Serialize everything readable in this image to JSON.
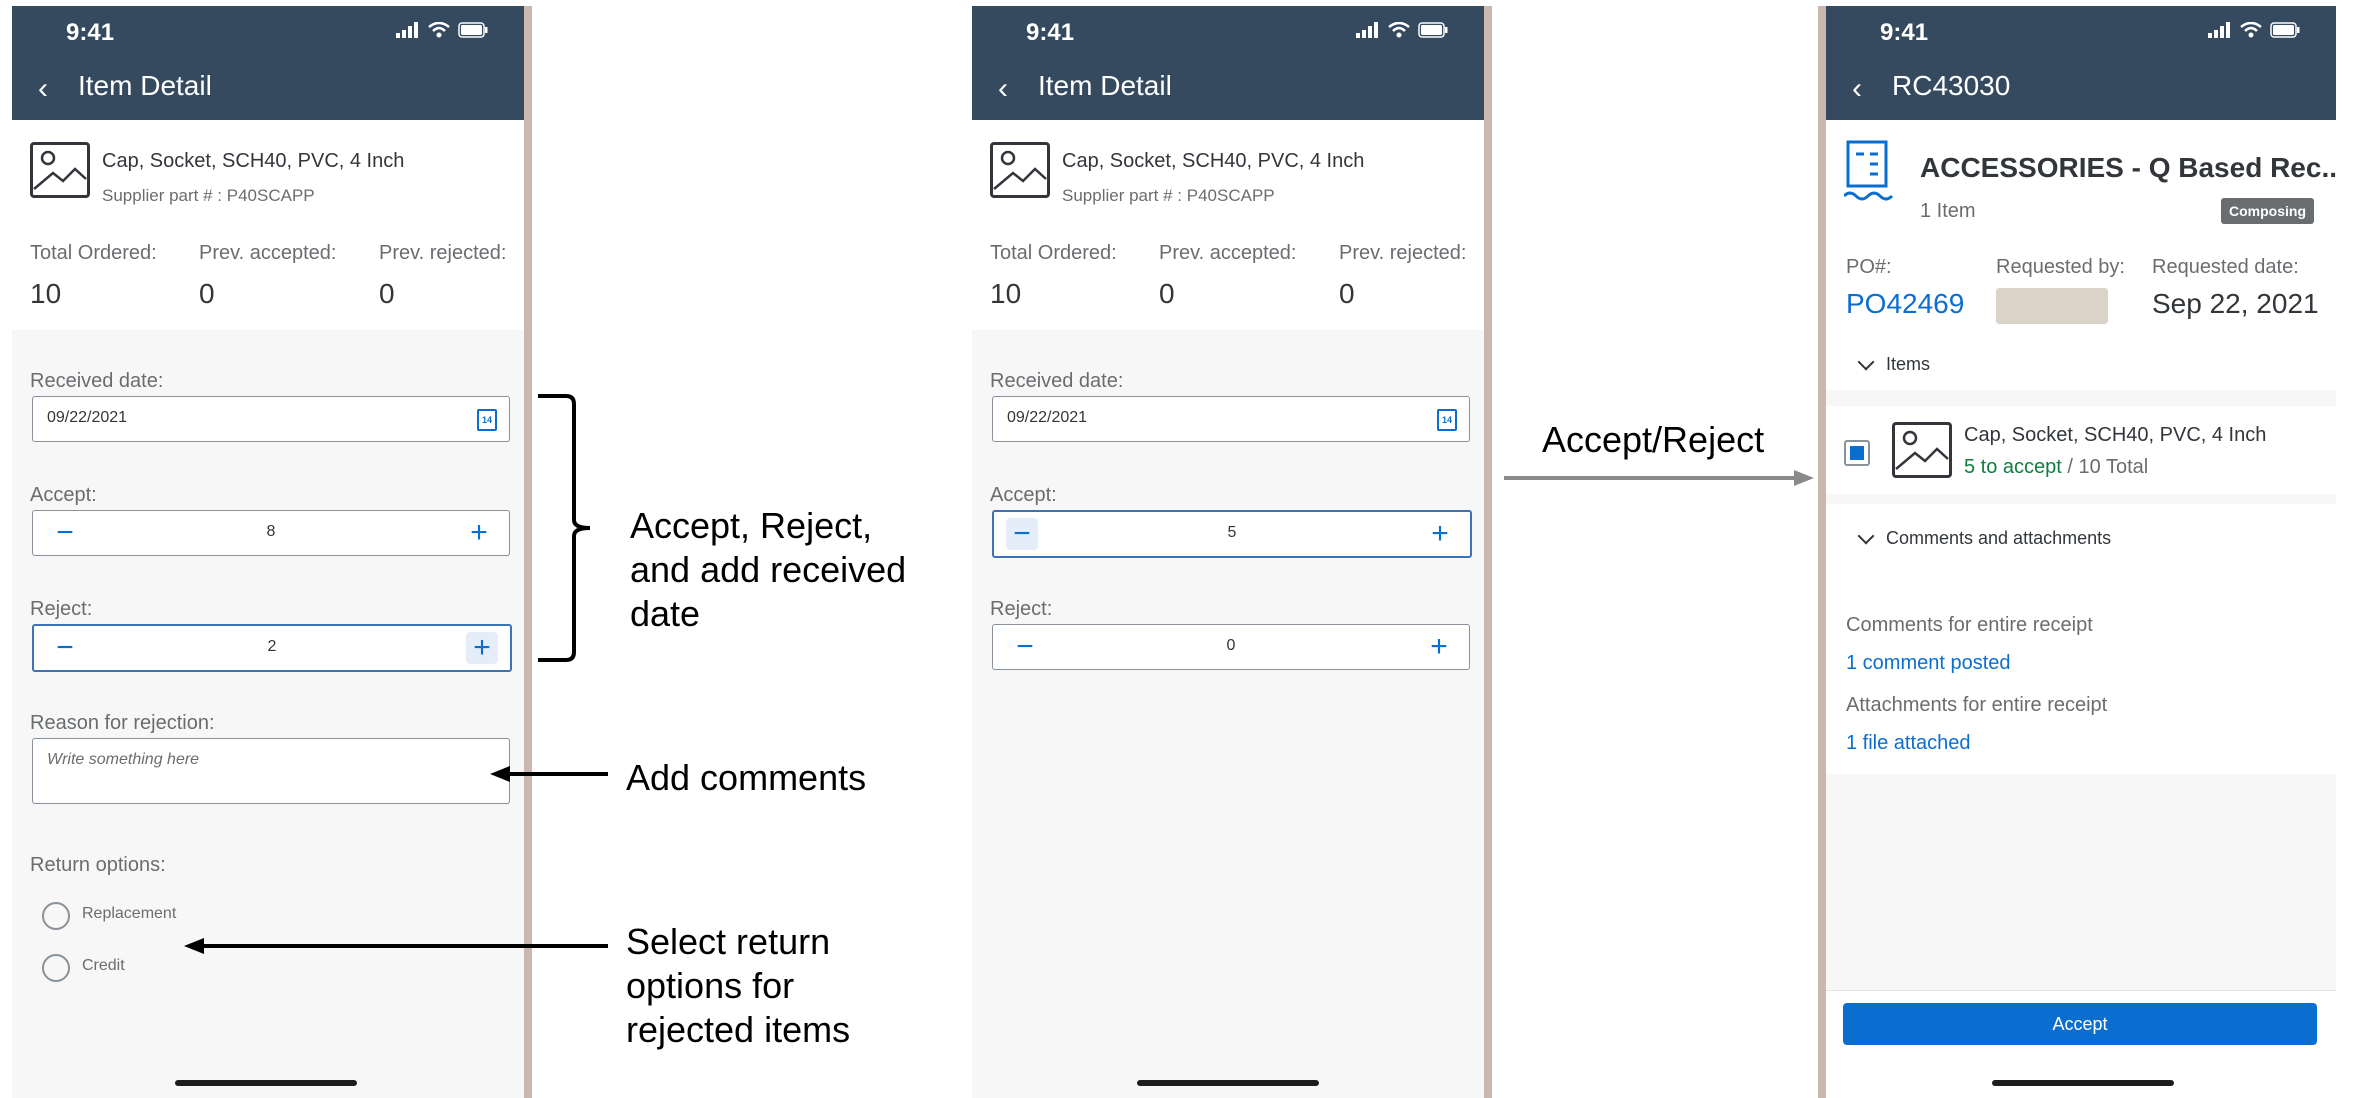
{
  "status_time": "9:41",
  "screen1": {
    "title": "Item Detail",
    "item_name": "Cap, Socket, SCH40, PVC, 4 Inch",
    "supplier_part": "Supplier part # : P40SCAPP",
    "totals": [
      {
        "label": "Total Ordered:",
        "value": "10"
      },
      {
        "label": "Prev. accepted:",
        "value": "0"
      },
      {
        "label": "Prev. rejected:",
        "value": "0"
      }
    ],
    "received_label": "Received date:",
    "received_value": "09/22/2021",
    "calendar_day": "14",
    "accept_label": "Accept:",
    "accept_value": "8",
    "reject_label": "Reject:",
    "reject_value": "2",
    "reason_label": "Reason for rejection:",
    "reason_placeholder": "Write something here",
    "return_label": "Return options:",
    "return_options": [
      "Replacement",
      "Credit"
    ]
  },
  "screen2": {
    "title": "Item Detail",
    "item_name": "Cap, Socket, SCH40, PVC, 4 Inch",
    "supplier_part": "Supplier part # : P40SCAPP",
    "totals": [
      {
        "label": "Total Ordered:",
        "value": "10"
      },
      {
        "label": "Prev. accepted:",
        "value": "0"
      },
      {
        "label": "Prev. rejected:",
        "value": "0"
      }
    ],
    "received_label": "Received date:",
    "received_value": "09/22/2021",
    "calendar_day": "14",
    "accept_label": "Accept:",
    "accept_value": "5",
    "reject_label": "Reject:",
    "reject_value": "0"
  },
  "screen3": {
    "title": "RC43030",
    "receipt_title": "ACCESSORIES - Q Based Rec...",
    "item_count": "1 Item",
    "status_badge": "Composing",
    "po_label": "PO#:",
    "po_value": "PO42469",
    "requested_by_label": "Requested by:",
    "requested_date_label": "Requested date:",
    "requested_date_value": "Sep 22, 2021",
    "items_section": "Items",
    "item_name": "Cap, Socket, SCH40, PVC, 4 Inch",
    "item_accept": "5 to accept",
    "item_total": " / 10 Total",
    "comments_section": "Comments and attachments",
    "comments_label": "Comments for entire receipt",
    "comments_link": "1 comment posted",
    "attachments_label": "Attachments for entire receipt",
    "attachments_link": "1 file attached",
    "accept_button": "Accept"
  },
  "annotations": {
    "accept_reject_date": [
      "Accept, Reject,",
      "and add received",
      "date"
    ],
    "add_comments": "Add comments",
    "select_return": [
      "Select return",
      "options for",
      "rejected items"
    ],
    "accept_reject": "Accept/Reject"
  },
  "colors": {
    "header": "#354a5f",
    "accent": "#0a6ed1",
    "positive": "#107e3e",
    "badge": "#6a6d70"
  }
}
